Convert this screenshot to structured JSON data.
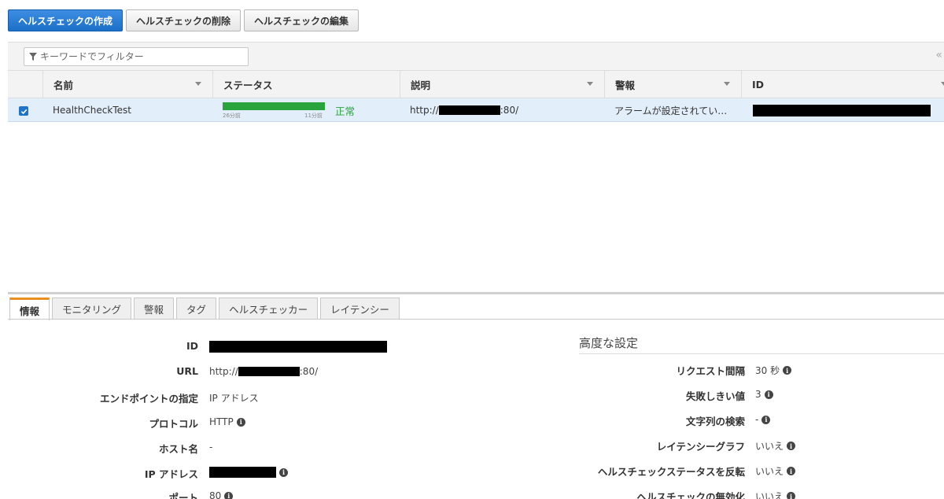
{
  "toolbar": {
    "create": "ヘルスチェックの作成",
    "delete": "ヘルスチェックの削除",
    "edit": "ヘルスチェックの編集"
  },
  "filter": {
    "placeholder": "キーワードでフィルター"
  },
  "table": {
    "headers": [
      "名前",
      "ステータス",
      "説明",
      "警報",
      "ID"
    ],
    "rows": [
      {
        "selected": true,
        "name": "HealthCheckTest",
        "status": "正常",
        "status_time_start": "26分前",
        "status_time_end": "11分前",
        "desc_prefix": "http://",
        "desc_suffix": ":80/",
        "alarm": "アラームが設定されてい…"
      }
    ]
  },
  "tabs": [
    "情報",
    "モニタリング",
    "警報",
    "タグ",
    "ヘルスチェッカー",
    "レイテンシー"
  ],
  "details_left": [
    {
      "label": "ID",
      "value": ""
    },
    {
      "label": "URL",
      "value_prefix": "http://",
      "value_suffix": ":80/"
    },
    {
      "label": "エンドポイントの指定",
      "value": "IP アドレス"
    },
    {
      "label": "プロトコル",
      "value": "HTTP"
    },
    {
      "label": "ホスト名",
      "value": "-"
    },
    {
      "label": "IP アドレス",
      "value": ""
    },
    {
      "label": "ポート",
      "value": "80"
    }
  ],
  "advanced": {
    "title": "高度な設定",
    "items": [
      {
        "label": "リクエスト間隔",
        "value": "30 秒"
      },
      {
        "label": "失敗しきい値",
        "value": "3"
      },
      {
        "label": "文字列の検索",
        "value": "-"
      },
      {
        "label": "レイテンシーグラフ",
        "value": "いいえ"
      },
      {
        "label": "ヘルスチェックステータスを反転",
        "value": "いいえ"
      },
      {
        "label": "ヘルスチェックの無効化",
        "value": "いいえ"
      }
    ]
  },
  "icons": {
    "info": "i",
    "collapse": "«"
  },
  "colors": {
    "primary": "#1c6fc7",
    "status_ok": "#29a33b",
    "active_tab": "#e98f1d",
    "selected_row": "#e2eefa"
  }
}
